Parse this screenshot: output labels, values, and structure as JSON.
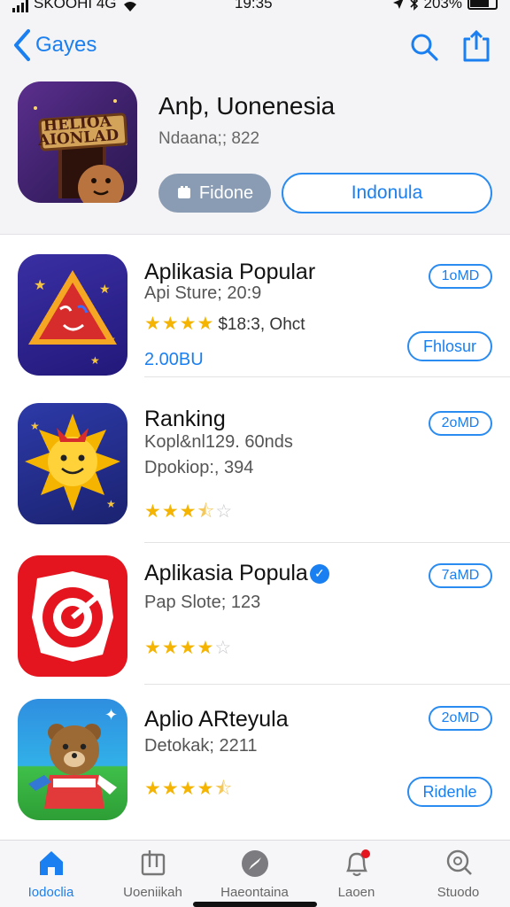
{
  "status_bar": {
    "carrier": "SKOOHI 4G",
    "time": "19:35",
    "battery": "203%"
  },
  "nav": {
    "back_label": "Gayes",
    "search_icon": "search-icon",
    "share_icon": "share-icon"
  },
  "featured": {
    "title": "Anþ, Uonenesia",
    "subtitle": "Ndaana;; 822",
    "icon_text": "HELIOA AIONLAD",
    "phone_button": "Fidone",
    "indo_button": "Indonula"
  },
  "apps": [
    {
      "name": "Aplikasia Popular",
      "line1": "Api Sture; 20:9",
      "rating_meta": "$18:3, Ohct",
      "price": "2.00BU",
      "size": "1oMD",
      "action": "Fhlosur",
      "stars_full": 4,
      "stars_half": 0,
      "stars_empty": 0
    },
    {
      "name": "Ranking",
      "line1": "Kopl&nl129. 60nds",
      "line2": "Dpokiop:, 394",
      "size": "2oMD",
      "stars_full": 3,
      "stars_half": 1,
      "stars_empty": 1
    },
    {
      "name": "Aplikasia Popula",
      "line1": "Pap Slote; 123",
      "size": "7aMD",
      "stars_full": 4,
      "stars_half": 0,
      "stars_empty": 1,
      "verified": true
    },
    {
      "name": "Aplio ARteyula",
      "line1": "Detokak; 2211",
      "size": "2oMD",
      "action": "Ridenle",
      "stars_full": 4,
      "stars_half": 1,
      "stars_empty": 0
    }
  ],
  "tabs": [
    {
      "label": "Iodoclia",
      "icon": "home-icon",
      "active": true
    },
    {
      "label": "Uoeniikah",
      "icon": "apps-icon"
    },
    {
      "label": "Haeontaina",
      "icon": "compass-icon"
    },
    {
      "label": "Laoen",
      "icon": "bell-icon"
    },
    {
      "label": "Stuodo",
      "icon": "search-icon"
    }
  ],
  "colors": {
    "accent": "#1a7ff0",
    "star": "#f5b400",
    "header_bg": "#f4f4f6"
  }
}
